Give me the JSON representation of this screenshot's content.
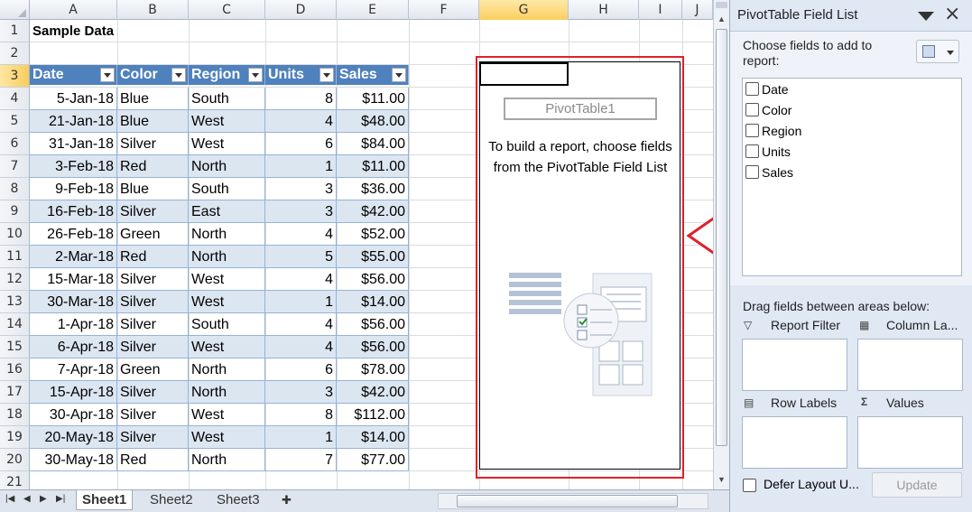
{
  "columns": [
    "A",
    "B",
    "C",
    "D",
    "E",
    "F",
    "G",
    "H",
    "I",
    "J"
  ],
  "rows": [
    "1",
    "2",
    "3",
    "4",
    "5",
    "6",
    "7",
    "8",
    "9",
    "10",
    "11",
    "12",
    "13",
    "14",
    "15",
    "16",
    "17",
    "18",
    "19",
    "20",
    "21"
  ],
  "title": "Sample Data",
  "table": {
    "headers": [
      "Date",
      "Color",
      "Region",
      "Units",
      "Sales"
    ],
    "rows": [
      [
        "5-Jan-18",
        "Blue",
        "South",
        "8",
        "$11.00"
      ],
      [
        "21-Jan-18",
        "Blue",
        "West",
        "4",
        "$48.00"
      ],
      [
        "31-Jan-18",
        "Silver",
        "West",
        "6",
        "$84.00"
      ],
      [
        "3-Feb-18",
        "Red",
        "North",
        "1",
        "$11.00"
      ],
      [
        "9-Feb-18",
        "Blue",
        "South",
        "3",
        "$36.00"
      ],
      [
        "16-Feb-18",
        "Silver",
        "East",
        "3",
        "$42.00"
      ],
      [
        "26-Feb-18",
        "Green",
        "North",
        "4",
        "$52.00"
      ],
      [
        "2-Mar-18",
        "Red",
        "North",
        "5",
        "$55.00"
      ],
      [
        "15-Mar-18",
        "Silver",
        "West",
        "4",
        "$56.00"
      ],
      [
        "30-Mar-18",
        "Silver",
        "West",
        "1",
        "$14.00"
      ],
      [
        "1-Apr-18",
        "Silver",
        "South",
        "4",
        "$56.00"
      ],
      [
        "6-Apr-18",
        "Silver",
        "West",
        "4",
        "$56.00"
      ],
      [
        "7-Apr-18",
        "Green",
        "North",
        "6",
        "$78.00"
      ],
      [
        "15-Apr-18",
        "Silver",
        "North",
        "3",
        "$42.00"
      ],
      [
        "30-Apr-18",
        "Silver",
        "West",
        "8",
        "$112.00"
      ],
      [
        "20-May-18",
        "Silver",
        "West",
        "1",
        "$14.00"
      ],
      [
        "30-May-18",
        "Red",
        "North",
        "7",
        "$77.00"
      ]
    ]
  },
  "pivot": {
    "name": "PivotTable1",
    "message_line1": "To build a report, choose fields",
    "message_line2": "from the PivotTable Field List"
  },
  "sheet_tabs": [
    "Sheet1",
    "Sheet2",
    "Sheet3"
  ],
  "field_list": {
    "title": "PivotTable Field List",
    "choose_label": "Choose fields to add to report:",
    "fields": [
      "Date",
      "Color",
      "Region",
      "Units",
      "Sales"
    ],
    "drag_label": "Drag fields between areas below:",
    "areas": {
      "report_filter": "Report Filter",
      "column_labels": "Column La...",
      "row_labels": "Row Labels",
      "values": "Values"
    },
    "defer_label": "Defer Layout U...",
    "update_label": "Update"
  },
  "colors": {
    "header_blue": "#4f81bd",
    "band": "#dce6f1",
    "highlight_red": "#e0202a"
  },
  "icons": [
    "split-handle-icon",
    "pivot-illustration-icon",
    "layout-options-icon",
    "filter-icon",
    "column-labels-icon",
    "row-labels-icon",
    "sigma-icon"
  ]
}
